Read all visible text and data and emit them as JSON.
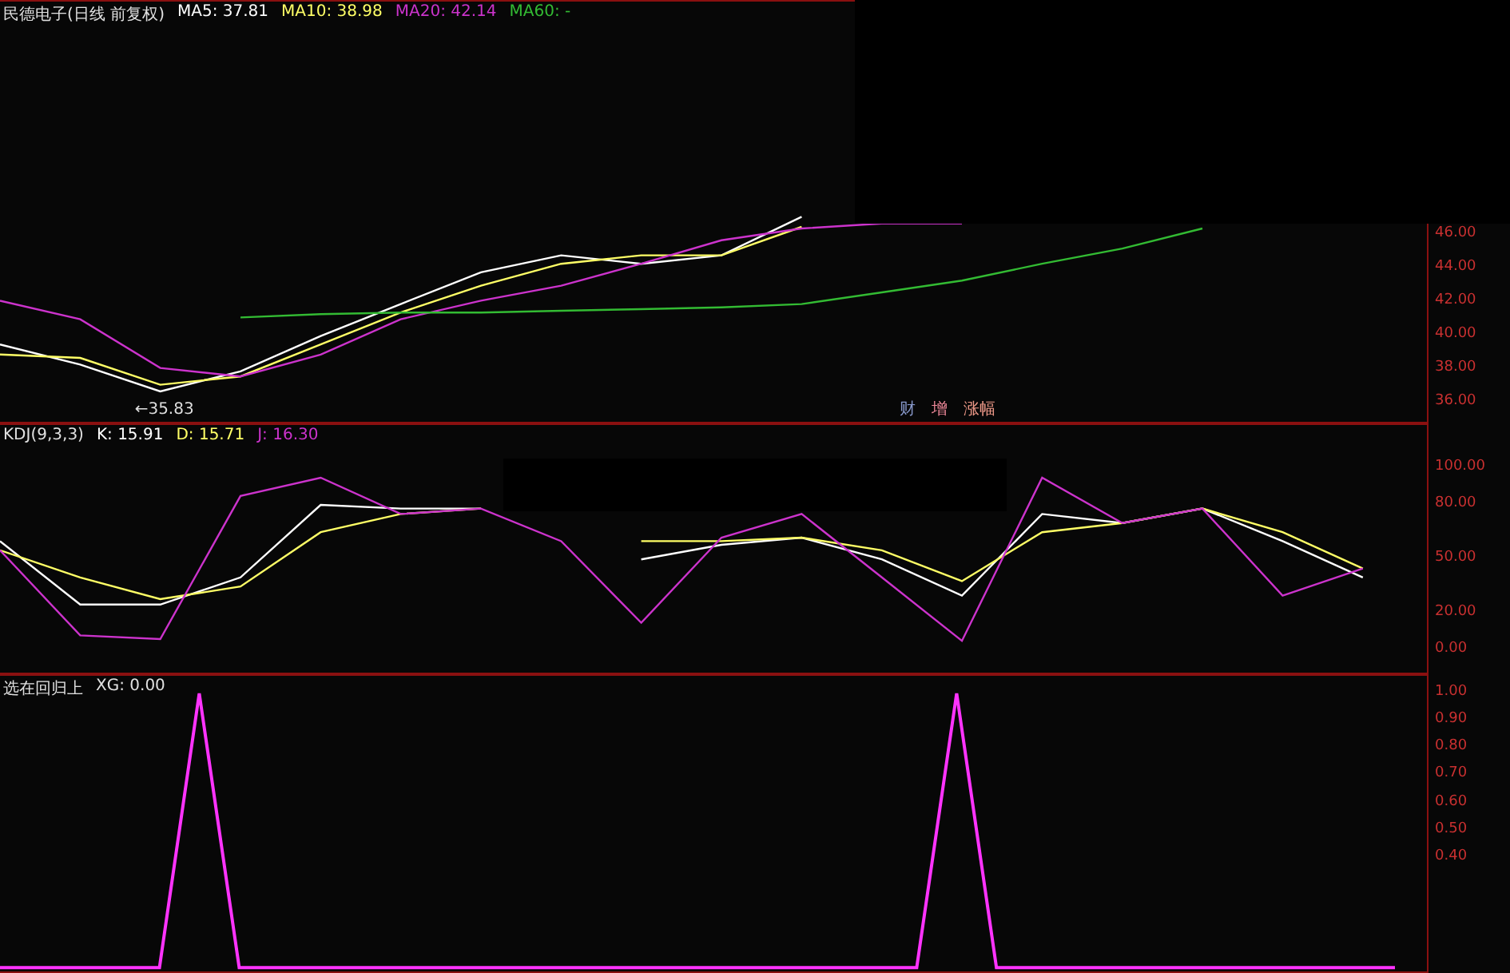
{
  "panels": [
    {
      "kind": "price",
      "title": "民德电子(日线 前复权)",
      "readings": [
        ": 37.81",
        ": 38.98",
        ": 42.14",
        ": -"
      ],
      "badges": [
        {
          "text": "财",
          "color": "#8899cc"
        },
        {
          "text": "增",
          "color": "#ee8899"
        },
        {
          "text": "涨幅",
          "color": "#ee9988"
        }
      ],
      "chart_data": {
        "type": "line",
        "ylim": [
          34.8,
          60
        ],
        "categories": [
          null,
          null,
          null,
          null,
          null,
          null,
          null,
          null,
          null,
          null,
          null,
          null,
          null,
          null,
          null,
          null,
          null,
          null
        ],
        "yticks": [
          {
            "value": 46,
            "label": "46.00"
          },
          {
            "value": 44,
            "label": "44.00"
          },
          {
            "value": 42,
            "label": "42.00"
          },
          {
            "value": 40,
            "label": "40.00"
          },
          {
            "value": 38,
            "label": "38.00"
          },
          {
            "value": 36,
            "label": "36.00"
          }
        ],
        "series": [
          {
            "name": "MA5",
            "color": "#ffffff",
            "values": [
              39.5,
              38.3,
              36.7,
              37.9,
              40.0,
              41.9,
              43.8,
              44.8,
              44.3,
              44.8,
              47.1,
              null,
              null,
              null,
              null,
              null,
              null,
              null
            ]
          },
          {
            "name": "MA10",
            "color": "#ffff66",
            "values": [
              38.9,
              38.7,
              37.1,
              37.6,
              39.5,
              41.4,
              43.0,
              44.3,
              44.8,
              44.8,
              46.5,
              null,
              null,
              null,
              null,
              null,
              null,
              null
            ]
          },
          {
            "name": "MA20",
            "color": "#cc33cc",
            "values": [
              42.1,
              41.0,
              38.1,
              37.6,
              38.9,
              41.0,
              42.1,
              43.0,
              44.3,
              45.7,
              46.4,
              46.7,
              46.7,
              null,
              null,
              null,
              null,
              null
            ]
          },
          {
            "name": "MA60",
            "color": "#33bb33",
            "values": [
              null,
              null,
              null,
              41.1,
              41.3,
              41.4,
              41.4,
              41.5,
              41.6,
              41.7,
              41.9,
              42.6,
              43.3,
              44.3,
              45.2,
              46.4,
              null,
              null
            ]
          }
        ],
        "annotations": [
          "←35.83"
        ]
      }
    },
    {
      "kind": "kdj",
      "title": "KDJ(9,3,3)",
      "readings": [
        ": 15.91",
        ": 15.71",
        ": 16.30"
      ],
      "chart_data": {
        "type": "line",
        "ylim": [
          -13.4,
          125
        ],
        "categories": [
          null,
          null,
          null,
          null,
          null,
          null,
          null,
          null,
          null,
          null,
          null,
          null,
          null,
          null,
          null,
          null,
          null,
          null
        ],
        "yticks": [
          {
            "value": 100,
            "label": "100.00"
          },
          {
            "value": 80,
            "label": "80.00"
          },
          {
            "value": 50,
            "label": "50.00"
          },
          {
            "value": 20,
            "label": "20.00"
          },
          {
            "value": 0,
            "label": "0.00"
          }
        ],
        "series": [
          {
            "name": "K",
            "color": "#ffffff",
            "values": [
              60,
              25,
              25,
              40,
              80,
              78,
              78,
              null,
              50,
              58,
              62,
              50,
              30,
              75,
              70,
              78,
              60,
              40
            ]
          },
          {
            "name": "D",
            "color": "#ffff66",
            "values": [
              55,
              40,
              28,
              35,
              65,
              75,
              78,
              null,
              60,
              60,
              62,
              55,
              38,
              65,
              70,
              78,
              65,
              45
            ]
          },
          {
            "name": "J",
            "color": "#cc33cc",
            "values": [
              55,
              8,
              6,
              85,
              95,
              75,
              78,
              60,
              15,
              62,
              75,
              40,
              5,
              95,
              70,
              78,
              30,
              45
            ]
          }
        ]
      }
    },
    {
      "kind": "signal",
      "title": "选在回归上",
      "readings": [
        ": 0.00"
      ],
      "chart_data": {
        "type": "line",
        "ylim": [
          -0.02,
          1.07
        ],
        "categories": [
          null,
          null,
          null,
          null,
          null,
          null,
          null,
          null,
          null,
          null,
          null,
          null,
          null,
          null,
          null,
          null,
          null,
          null,
          null,
          null,
          null,
          null,
          null,
          null,
          null,
          null,
          null,
          null,
          null,
          null,
          null,
          null,
          null,
          null,
          null,
          null
        ],
        "yticks": [
          {
            "value": 1,
            "label": "1.00"
          },
          {
            "value": 0.9,
            "label": "0.90"
          },
          {
            "value": 0.8,
            "label": "0.80"
          },
          {
            "value": 0.7,
            "label": "0.70"
          },
          {
            "value": 0.6,
            "label": "0.60"
          },
          {
            "value": 0.5,
            "label": "0.50"
          },
          {
            "value": 0.4,
            "label": "0.40"
          }
        ],
        "series": [
          {
            "name": "XG",
            "color": "#ff33ff",
            "values": [
              0,
              0,
              0,
              0,
              0,
              1,
              0,
              0,
              0,
              0,
              0,
              0,
              0,
              0,
              0,
              0,
              0,
              0,
              0,
              0,
              0,
              0,
              0,
              0,
              1,
              0,
              0,
              0,
              0,
              0,
              0,
              0,
              0,
              0,
              0,
              0
            ]
          }
        ]
      }
    }
  ]
}
